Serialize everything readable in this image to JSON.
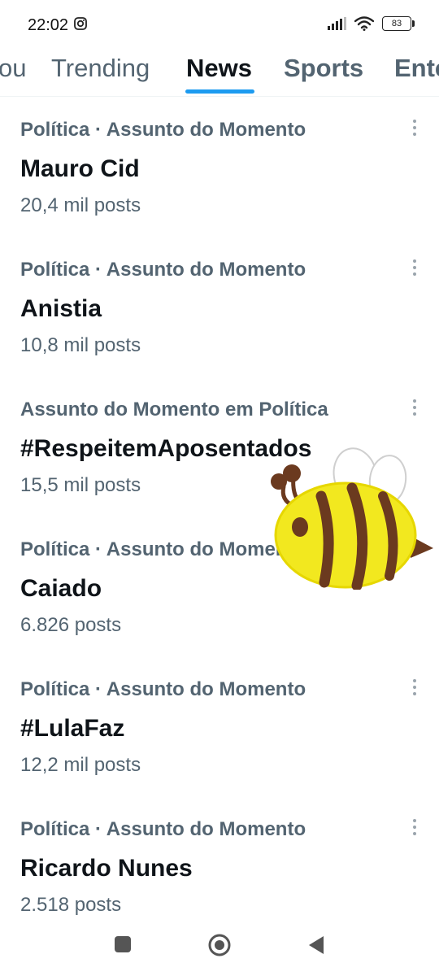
{
  "status_bar": {
    "time": "22:02",
    "battery": "83",
    "icons": [
      "instagram-icon",
      "signal-icon",
      "wifi-icon",
      "battery-icon"
    ]
  },
  "tabs": [
    {
      "label": "For you",
      "visible_text": "ou",
      "active": false
    },
    {
      "label": "Trending",
      "active": false
    },
    {
      "label": "News",
      "active": true
    },
    {
      "label": "Sports",
      "active": false
    },
    {
      "label": "Entertainment",
      "visible_text": "Ente",
      "active": false
    }
  ],
  "accent_color": "#1d9bf0",
  "trends": [
    {
      "context": "Política · Assunto do Momento",
      "name": "Mauro Cid",
      "count": "20,4 mil posts"
    },
    {
      "context": "Política · Assunto do Momento",
      "name": "Anistia",
      "count": "10,8 mil posts"
    },
    {
      "context": "Assunto do Momento em Política",
      "name": "#RespeitemAposentados",
      "count": "15,5 mil posts"
    },
    {
      "context": "Política · Assunto do Momento",
      "name": "Caiado",
      "count": "6.826 posts"
    },
    {
      "context": "Política · Assunto do Momento",
      "name": "#LulaFaz",
      "count": "12,2 mil posts"
    },
    {
      "context": "Política · Assunto do Momento",
      "name": "Ricardo Nunes",
      "count": "2.518 posts"
    }
  ],
  "sticker": {
    "subject": "bee-sticker"
  },
  "nav_bar": {
    "buttons": [
      "recents-square-icon",
      "home-circle-icon",
      "back-triangle-icon"
    ]
  }
}
